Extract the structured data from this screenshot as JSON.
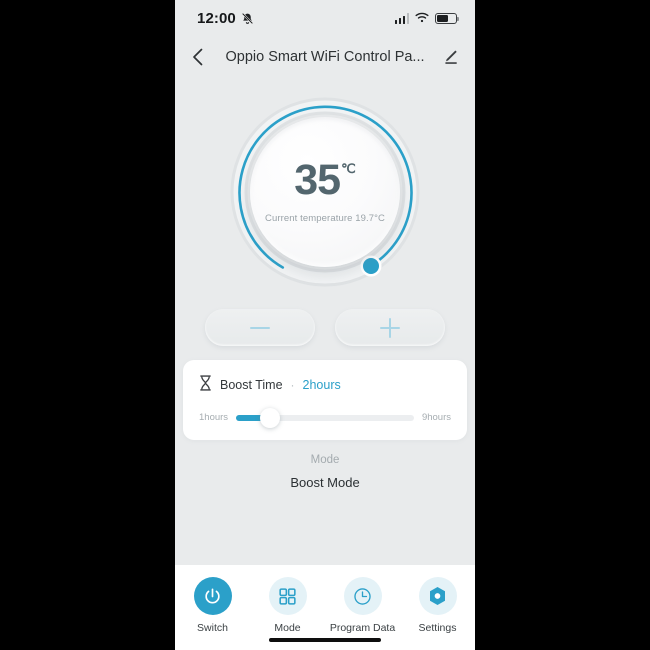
{
  "status_bar": {
    "time": "12:00",
    "bell_icon": "bell-muted-icon",
    "signal_icon": "cellular-signal-icon",
    "wifi_icon": "wifi-icon",
    "battery_icon": "battery-icon"
  },
  "header": {
    "back_icon": "chevron-left-icon",
    "title": "Oppio Smart WiFi Control Pa...",
    "edit_icon": "pencil-edit-icon"
  },
  "dial": {
    "target_temp": "35",
    "unit": "℃",
    "current_temp_text": "Current temperature 19.7°C",
    "arc_color": "#2ba0c9",
    "track_color": "#dfe2e4",
    "knob_color": "#2ba0c9"
  },
  "stepper": {
    "minus_icon": "minus-icon",
    "plus_icon": "plus-icon",
    "icon_color": "#a8d5e6"
  },
  "boost_card": {
    "icon": "hourglass-icon",
    "title": "Boost Time",
    "separator": "·",
    "value": "2hours",
    "value_color": "#2ba0c9",
    "slider": {
      "min_label": "1hours",
      "max_label": "9hours",
      "fill_percent": 19
    }
  },
  "mode": {
    "label": "Mode",
    "value": "Boost Mode"
  },
  "bottom_nav": {
    "items": [
      {
        "label": "Switch",
        "icon": "power-icon",
        "active": true
      },
      {
        "label": "Mode",
        "icon": "grid-icon",
        "active": false
      },
      {
        "label": "Program Data",
        "icon": "clock-icon",
        "active": false
      },
      {
        "label": "Settings",
        "icon": "hex-nut-settings-icon",
        "active": false
      }
    ],
    "active_color": "#2ba0c9",
    "inactive_bg": "#e4f2f7"
  }
}
